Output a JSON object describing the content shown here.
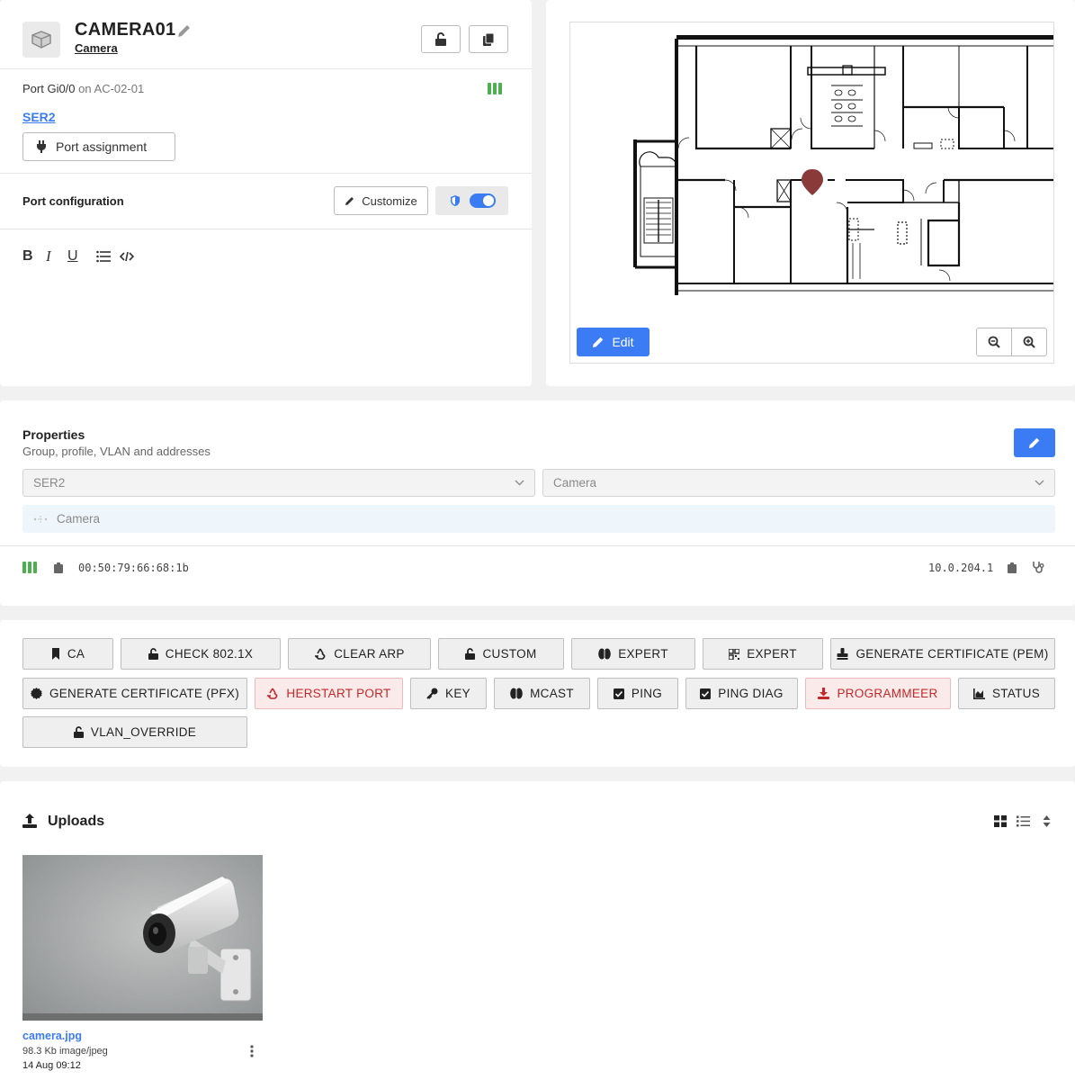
{
  "device": {
    "name": "CAMERA01",
    "type_link": "Camera",
    "port_label": "Port Gi0/0",
    "port_on": "on",
    "switch": "AC-02-01",
    "group_link": "SER2",
    "port_assignment_label": "Port assignment"
  },
  "port_config": {
    "title": "Port configuration",
    "customize_label": "Customize",
    "toggle_on": true
  },
  "map": {
    "edit_label": "Edit"
  },
  "properties": {
    "title": "Properties",
    "subtitle": "Group, profile, VLAN and addresses",
    "group_select": "SER2",
    "profile_select": "Camera",
    "vlan_tag": "Camera",
    "mac": "00:50:79:66:68:1b",
    "ip": "10.0.204.1"
  },
  "actions": [
    {
      "label": "CA",
      "icon": "bookmark-icon",
      "danger": false
    },
    {
      "label": "CHECK 802.1X",
      "icon": "lock-open-icon",
      "danger": false
    },
    {
      "label": "CLEAR ARP",
      "icon": "recycle-icon",
      "danger": false
    },
    {
      "label": "CUSTOM",
      "icon": "lock-open-icon",
      "danger": false
    },
    {
      "label": "EXPERT",
      "icon": "brain-icon",
      "danger": false
    },
    {
      "label": "EXPERT",
      "icon": "qrcode-icon",
      "danger": false
    },
    {
      "label": "GENERATE CERTIFICATE (PEM)",
      "icon": "stamp-icon",
      "danger": false
    },
    {
      "label": "GENERATE CERTIFICATE (PFX)",
      "icon": "certificate-icon",
      "danger": false
    },
    {
      "label": "HERSTART PORT",
      "icon": "recycle-icon",
      "danger": true
    },
    {
      "label": "KEY",
      "icon": "key-icon",
      "danger": false
    },
    {
      "label": "MCAST",
      "icon": "brain-icon",
      "danger": false
    },
    {
      "label": "PING",
      "icon": "checkbox-icon",
      "danger": false
    },
    {
      "label": "PING DIAG",
      "icon": "checkbox-icon",
      "danger": false
    },
    {
      "label": "PROGRAMMEER",
      "icon": "download-icon",
      "danger": true
    },
    {
      "label": "STATUS",
      "icon": "chart-area-icon",
      "danger": false
    },
    {
      "label": "VLAN_OVERRIDE",
      "icon": "lock-open-icon",
      "danger": false
    }
  ],
  "uploads": {
    "title": "Uploads",
    "files": [
      {
        "name": "camera.jpg",
        "size": "98.3 Kb",
        "mime": "image/jpeg",
        "date": "14 Aug 09:12"
      }
    ]
  },
  "colors": {
    "accent": "#3b7cf5",
    "danger": "#c62828",
    "status_green": "#4caf50"
  }
}
